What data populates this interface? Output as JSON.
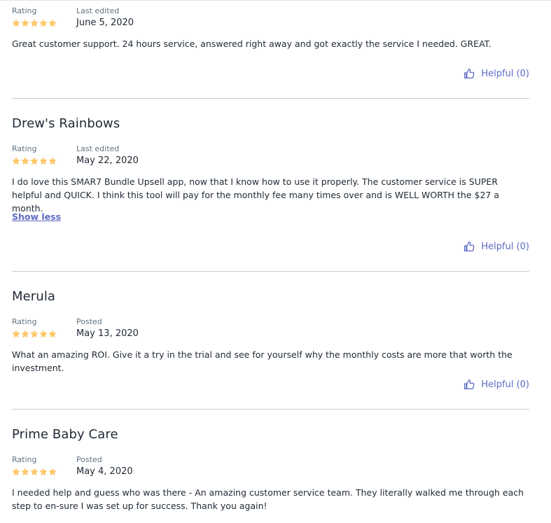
{
  "colors": {
    "accent": "#5c6ac4",
    "star": "#ffc96b",
    "divider": "#c4cdd5"
  },
  "icons": {
    "rating": "star-icon",
    "helpful": "thumbs-up-icon"
  },
  "reviews": [
    {
      "reviewer": "",
      "rating_label": "Rating",
      "rating": 5,
      "date_label": "Last edited",
      "date": "June 5, 2020",
      "body": "Great customer support. 24 hours service, answered right away and got exactly the service I needed. GREAT.",
      "show_less": "",
      "helpful": "Helpful (0)"
    },
    {
      "reviewer": "Drew's Rainbows",
      "rating_label": "Rating",
      "rating": 5,
      "date_label": "Last edited",
      "date": "May 22, 2020",
      "body": "I do love this SMAR7 Bundle Upsell app, now that I know how to use it properly. The customer service is SUPER helpful and QUICK. I think this tool will pay for the monthly fee many times over and is WELL WORTH the $27 a month.",
      "show_less": "Show less",
      "helpful": "Helpful (0)"
    },
    {
      "reviewer": "Merula",
      "rating_label": "Rating",
      "rating": 5,
      "date_label": "Posted",
      "date": "May 13, 2020",
      "body": "What an amazing ROI. Give it a try in the trial and see for yourself why the monthly costs are more that worth the investment.",
      "show_less": "",
      "helpful": "Helpful (0)"
    },
    {
      "reviewer": "Prime Baby Care",
      "rating_label": "Rating",
      "rating": 5,
      "date_label": "Posted",
      "date": "May 4, 2020",
      "body": "I needed help and guess who was there - An amazing customer service team. They literally walked me through each step to en-sure I was set up for success. Thank you again!",
      "show_less": "",
      "helpful": ""
    }
  ]
}
